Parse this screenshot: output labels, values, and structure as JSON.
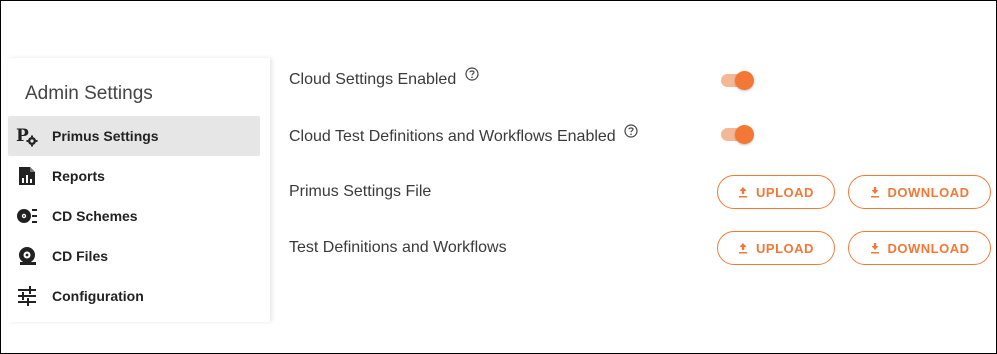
{
  "sidebar": {
    "title": "Admin Settings",
    "items": [
      {
        "label": "Primus Settings",
        "icon": "primus-settings-icon",
        "active": true
      },
      {
        "label": "Reports",
        "icon": "report-icon",
        "active": false
      },
      {
        "label": "CD Schemes",
        "icon": "cd-schemes-icon",
        "active": false
      },
      {
        "label": "CD Files",
        "icon": "cd-files-icon",
        "active": false
      },
      {
        "label": "Configuration",
        "icon": "sliders-icon",
        "active": false
      }
    ]
  },
  "main": {
    "rows": [
      {
        "label": "Cloud Settings Enabled",
        "help": true,
        "control": "toggle",
        "enabled": true
      },
      {
        "label": "Cloud Test Definitions and Workflows Enabled",
        "help": true,
        "control": "toggle",
        "enabled": true
      },
      {
        "label": "Primus Settings File",
        "help": false,
        "control": "buttons",
        "upload_label": "UPLOAD",
        "download_label": "DOWNLOAD"
      },
      {
        "label": "Test Definitions and Workflows",
        "help": false,
        "control": "buttons",
        "upload_label": "UPLOAD",
        "download_label": "DOWNLOAD"
      }
    ]
  },
  "colors": {
    "accent": "#f37835",
    "accent_light": "#f5b896",
    "active_nav_bg": "#e6e6e6"
  }
}
